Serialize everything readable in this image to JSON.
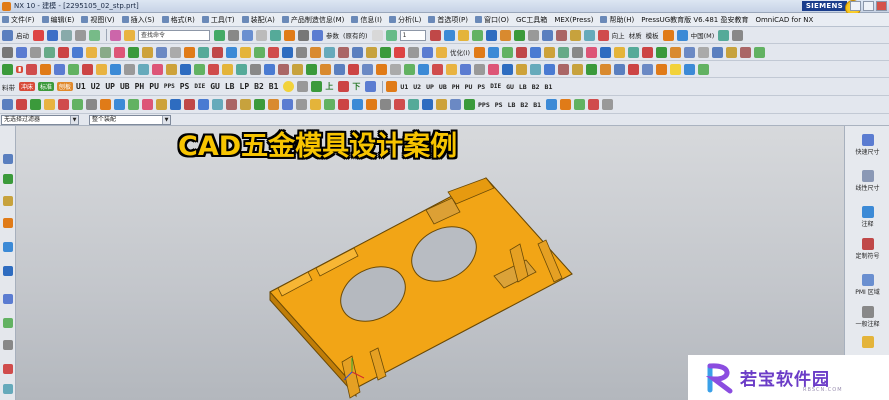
{
  "window": {
    "title": "NX 10 - 建模 - [2295105_02_stp.prt]",
    "brand": "SIEMENS"
  },
  "menu": [
    {
      "label": "文件(F)"
    },
    {
      "label": "编辑(E)"
    },
    {
      "label": "视图(V)"
    },
    {
      "label": "插入(S)"
    },
    {
      "label": "格式(R)"
    },
    {
      "label": "工具(T)"
    },
    {
      "label": "装配(A)"
    },
    {
      "label": "产品制造信息(M)"
    },
    {
      "label": "信息(I)"
    },
    {
      "label": "分析(L)"
    },
    {
      "label": "首选项(P)"
    },
    {
      "label": "窗口(O)"
    },
    {
      "label": "GC工具箱"
    },
    {
      "label": "MEX(Press)"
    },
    {
      "label": "帮助(H)"
    },
    {
      "label": "PressUG教育版 V6.481 盈安教育"
    },
    {
      "label": "OmniCAD for NX"
    }
  ],
  "toolbar1": {
    "start_label": "启动",
    "command_finder_placeholder": "查找命令",
    "layer_value": "1",
    "label_params": "参数",
    "label_original": "(原有的)",
    "label_up": "向上",
    "label_material": "材质",
    "label_template": "模板",
    "label_china": "中国(M)"
  },
  "toolbar2": {
    "label_optimize": "优化(I)"
  },
  "toolbar3": {
    "label_material": "料带",
    "chip_punch": "冲床",
    "chip_mark": "标准",
    "chip_board": "刨板",
    "codes_a": [
      "U1",
      "U2",
      "UP",
      "UB",
      "PH",
      "PU",
      "PPS",
      "PS",
      "DIE",
      "GU",
      "LB",
      "LP",
      "B2",
      "B1"
    ],
    "label_top": "上",
    "label_down": "下",
    "codes_b": [
      "U1",
      "U2",
      "UP",
      "UB",
      "PH",
      "PU",
      "PS",
      "DIE",
      "GU",
      "LB",
      "B2",
      "B1"
    ],
    "codes_c": [
      "PPS",
      "PS",
      "LB",
      "B2",
      "B1"
    ]
  },
  "filter": {
    "selection_filter": "无选择过滤器",
    "assembly_scope": "整个装配"
  },
  "overlay": {
    "title": "CAD五金模具设计案例"
  },
  "right_panel": [
    {
      "label": "快速尺寸"
    },
    {
      "label": "线性尺寸"
    },
    {
      "label": "注释"
    },
    {
      "label": "定制符号"
    },
    {
      "label": "PMI 区域"
    },
    {
      "label": "一般注释"
    }
  ],
  "watermark": {
    "name": "若宝软件园",
    "url": "RBSCN.COM"
  },
  "colors": {
    "part_body": "#f2a516",
    "part_edge": "#6b4a06",
    "overlay_title": "#f7c400",
    "watermark_text": "#6b3cc7"
  }
}
